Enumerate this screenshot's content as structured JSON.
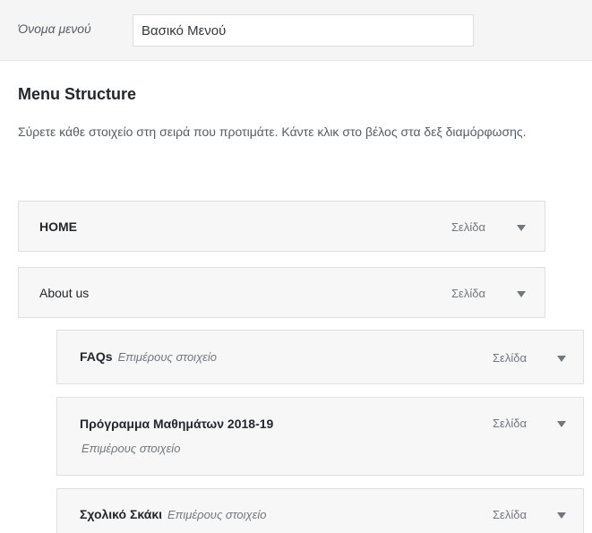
{
  "menu_name": {
    "label": "Όνομα μενού",
    "value": "Βασικό Μενού"
  },
  "structure": {
    "title": "Menu Structure",
    "instructions": "Σύρετε κάθε στοιχείο στη σειρά που προτιμάτε. Κάντε κλικ στο βέλος στα δεξ διαμόρφωσης."
  },
  "items": [
    {
      "title": "HOME",
      "sub": "",
      "type": "Σελίδα",
      "depth": 0,
      "icon": "triangle-down-icon"
    },
    {
      "title": "About us",
      "sub": "",
      "type": "Σελίδα",
      "depth": 0,
      "icon": "triangle-down-icon"
    },
    {
      "title": "FAQs",
      "sub": "Επιμέρους στοιχείο",
      "type": "Σελίδα",
      "depth": 1,
      "icon": "triangle-down-icon"
    },
    {
      "title": "Πρόγραμμα Μαθημάτων 2018-19",
      "sub": "Επιμέρους στοιχείο",
      "type": "Σελίδα",
      "depth": 1,
      "icon": "triangle-down-icon"
    },
    {
      "title": "Σχολικό Σκάκι",
      "sub": "Επιμέρους στοιχείο",
      "type": "Σελίδα",
      "depth": 1,
      "icon": "triangle-down-icon"
    }
  ],
  "colors": {
    "item_bg": "#f7f7f7",
    "item_border": "#dfdfdf",
    "muted_text": "#72777c"
  }
}
